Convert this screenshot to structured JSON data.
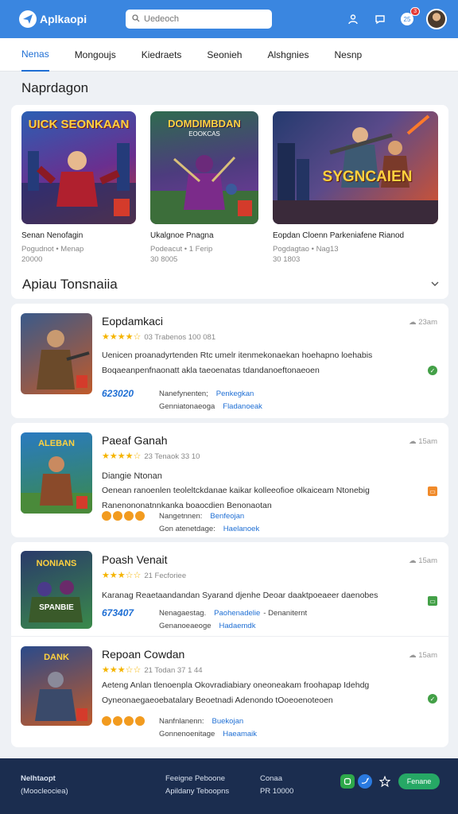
{
  "header": {
    "app_name": "Aplkaopi",
    "search_placeholder": "Uedeoch",
    "notification_count": "3"
  },
  "tabs": [
    {
      "label": "Nenas",
      "active": true
    },
    {
      "label": "Mongoujs",
      "active": false
    },
    {
      "label": "Kiedraets",
      "active": false
    },
    {
      "label": "Seonieh",
      "active": false
    },
    {
      "label": "Alshgnies",
      "active": false
    },
    {
      "label": "Nesnp",
      "active": false
    }
  ],
  "featured": {
    "title": "Naprdagon",
    "cards": [
      {
        "art_title": "UICK SEONKAAN",
        "name": "Senan Nenofagin",
        "meta1": "Pogudnot • Menap",
        "meta2": "20000"
      },
      {
        "art_title": "DOMDIMBDAN",
        "art_sub": "EOOKCAS",
        "name": "Ukalgnoe Pnagna",
        "meta1": "Podeacut • 1 Ferip",
        "meta2": "30 8005"
      },
      {
        "art_title": "SYGNCAIEN",
        "name": "Eopdan Cloenn Parkeniafene Rianod",
        "meta1": "Pogdagtao • Nag13",
        "meta2": "30 1803"
      }
    ]
  },
  "list_section": {
    "title": "Apiau Tonsnaiia",
    "items": [
      {
        "name": "Eopdamkaci",
        "rating_text": "03 Trabenos 100 081",
        "time": "23am",
        "desc": "Uenicen proanadyrtenden Rtc umelr itenmekonaekan hoehapno loehabis Boqaeanpenfnaonatt akla taeoenatas tdandanoeftonaeoen",
        "price": "623020",
        "dl1": "Nanefynenten;",
        "link1": "Penkegkan",
        "dl2": "Genniatonaeoga",
        "link2": "Fladanoeak"
      },
      {
        "name": "Paeaf Ganah",
        "rating_text": "23 Tenaok 33 10",
        "time": "15am",
        "tagline": "Diangie Ntonan",
        "desc": "Oenean ranoenlen teoleltckdanae kaikar kolleeofioe olkaiceam Ntonebig Ranenononatnnkanka boaocdien Benonaotan",
        "dl1": "Nangetnnen:",
        "link1": "Benfeojan",
        "dl2": "Gon atenetdage:",
        "link2": "Haelanoek"
      },
      {
        "name": "Poash Venait",
        "rating_text": "21 Fecforiee",
        "time": "15am",
        "desc": "Karanag Reaetaandandan Syarand djenhe Deoar daaktpoeaeer daenobes",
        "price": "673407",
        "dl1": "Nenagaestag.",
        "link1": "Paohenadelie",
        "link1b": "- Denaniternt",
        "dl2": "Genanoeaeoge",
        "link2": "Hadaemdk"
      },
      {
        "name": "Repoan Cowdan",
        "rating_text": "21 Todan 37 1 44",
        "time": "15am",
        "desc": "Aeteng Anlan tlenoenpla Okovradiabiary oneoneakam froohapap Idehdg Oyneonaegaeoebatalary Beoetnadi Adenondo tOoeoenoteoen",
        "dl1": "Nanfnlanenn:",
        "link1": "Buekojan",
        "dl2": "Gonnenoenitage",
        "link2": "Haeamaik"
      }
    ]
  },
  "footer": {
    "brand": "Nelhtaopt",
    "brand_sub": "(Moocleociea)",
    "col2_line1": "Feeigne Peboone",
    "col2_line2": "Apildany Teboopns",
    "col3_line1": "Conaa",
    "col3_line2": "PR 10000",
    "cta_label": "Fenane"
  },
  "colors": {
    "header_bg": "#3a86e0",
    "accent": "#1f6fd4",
    "footer_bg": "#1b2d4f",
    "star": "#f5b400",
    "success": "#43a047"
  }
}
